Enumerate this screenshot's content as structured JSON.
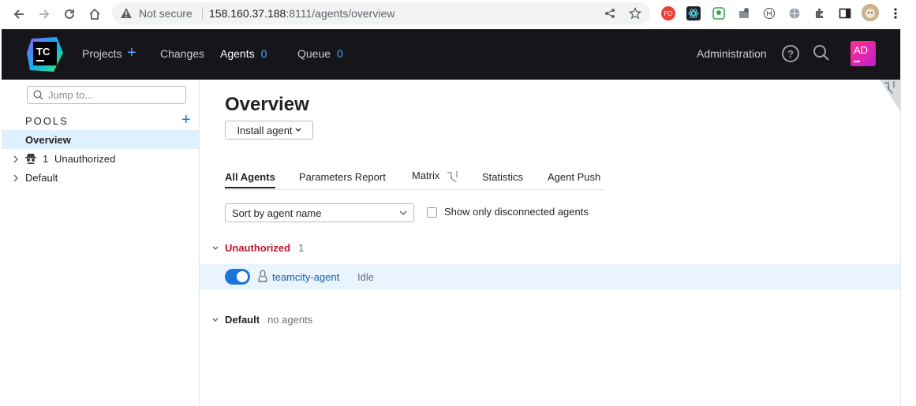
{
  "browser": {
    "not_secure": "Not secure",
    "url_host": "158.160.37.188",
    "url_rest": ":8111/agents/overview",
    "ext_badge": "FO"
  },
  "header": {
    "logo_text": "TC",
    "projects": "Projects",
    "changes": "Changes",
    "agents": "Agents",
    "agents_count": "0",
    "queue": "Queue",
    "queue_count": "0",
    "administration": "Administration",
    "help": "?",
    "avatar": "AD",
    "colors": {
      "bg": "#16161a",
      "accent": "#4da3ff",
      "avatar": "#ff318c"
    }
  },
  "sidebar": {
    "search_placeholder": "Jump to...",
    "pools_label": "POOLS",
    "items": [
      {
        "label": "Overview"
      },
      {
        "count": "1",
        "label": "Unauthorized"
      },
      {
        "label": "Default"
      }
    ]
  },
  "main": {
    "title": "Overview",
    "install_button": "Install agent",
    "tabs": [
      {
        "label": "All Agents"
      },
      {
        "label": "Parameters Report"
      },
      {
        "label": "Matrix"
      },
      {
        "label": "Statistics"
      },
      {
        "label": "Agent Push"
      }
    ],
    "sort_select": "Sort by agent name",
    "disconnected_checkbox": "Show only disconnected agents",
    "groups": {
      "unauthorized": {
        "label": "Unauthorized",
        "count": "1"
      },
      "default": {
        "label": "Default",
        "note": "no agents"
      }
    },
    "agent": {
      "name": "teamcity-agent",
      "status": "Idle",
      "enabled": true
    }
  }
}
